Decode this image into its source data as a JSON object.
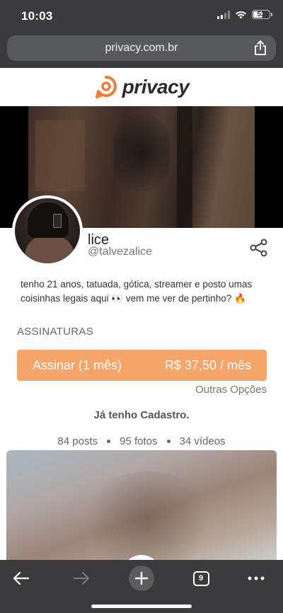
{
  "status_bar": {
    "time": "10:03",
    "battery": "53"
  },
  "browser": {
    "url": "privacy.com.br",
    "tab_count": "9"
  },
  "site": {
    "logo_text": "privacy",
    "brand_color": "#f07b39"
  },
  "profile": {
    "name": "lice",
    "handle": "@talvezalice",
    "bio": "tenho 21 anos, tatuada, gótica, streamer e posto umas coisinhas legais aqui 👀 vem me ver de pertinho? 🔥"
  },
  "subscriptions": {
    "section_label": "ASSINATURAS",
    "plan_label": "Assinar (1 mês)",
    "plan_price": "R$ 37,50 / mês",
    "button_color": "#f6a56a",
    "other_options": "Outras Opções"
  },
  "account": {
    "have_account": "Já tenho Cadastro."
  },
  "stats": {
    "posts": "84 posts",
    "photos": "95 fotos",
    "videos": "34 vídeos"
  },
  "icons": {
    "share": "share-nodes-icon",
    "browser_share": "share-up-icon",
    "back": "arrow-left-icon",
    "forward": "arrow-right-icon",
    "new_tab": "plus-icon",
    "tabs": "tabs-icon",
    "more": "more-dots-icon"
  }
}
